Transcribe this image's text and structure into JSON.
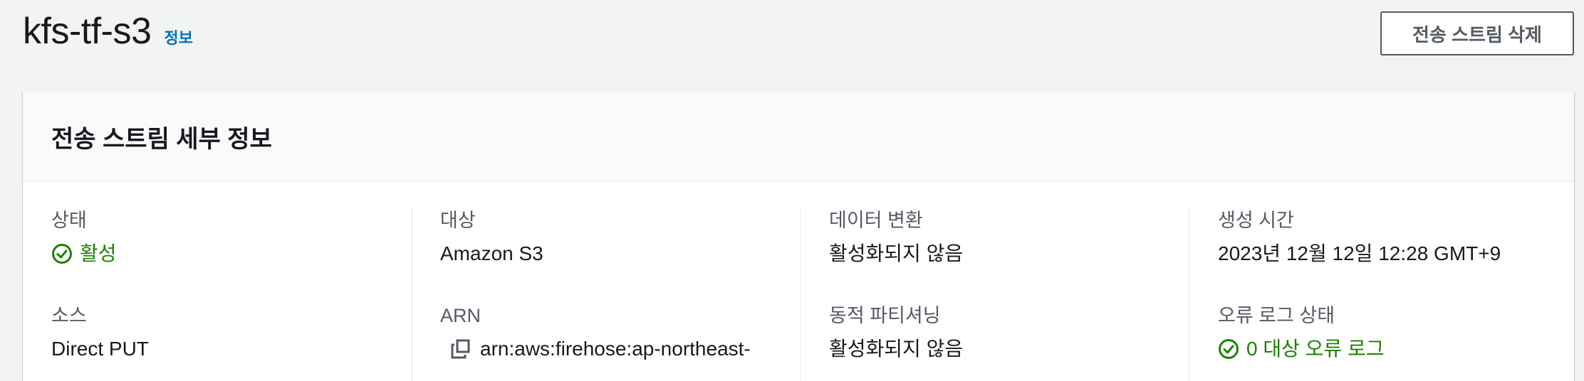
{
  "header": {
    "title": "kfs-tf-s3",
    "info_link": "정보",
    "delete_button": "전송 스트림 삭제"
  },
  "card": {
    "title": "전송 스트림 세부 정보",
    "columns": [
      {
        "fields": [
          {
            "label": "상태",
            "value": "활성",
            "icon": "check-circle-icon",
            "status_color": "#1d8102"
          },
          {
            "label": "소스",
            "value": "Direct PUT"
          }
        ]
      },
      {
        "fields": [
          {
            "label": "대상",
            "value": "Amazon S3"
          },
          {
            "label": "ARN",
            "value": "arn:aws:firehose:ap-northeast-",
            "icon": "copy-icon"
          }
        ]
      },
      {
        "fields": [
          {
            "label": "데이터 변환",
            "value": "활성화되지 않음"
          },
          {
            "label": "동적 파티셔닝",
            "value": "활성화되지 않음"
          }
        ]
      },
      {
        "fields": [
          {
            "label": "생성 시간",
            "value": "2023년 12월 12일 12:28 GMT+9"
          },
          {
            "label": "오류 로그 상태",
            "value": "0 대상 오류 로그",
            "icon": "check-circle-icon",
            "status_color": "#1d8102"
          }
        ]
      }
    ]
  },
  "colors": {
    "background": "#f2f3f3",
    "link": "#0073bb",
    "success": "#1d8102",
    "label": "#545b64",
    "text": "#16191f"
  }
}
